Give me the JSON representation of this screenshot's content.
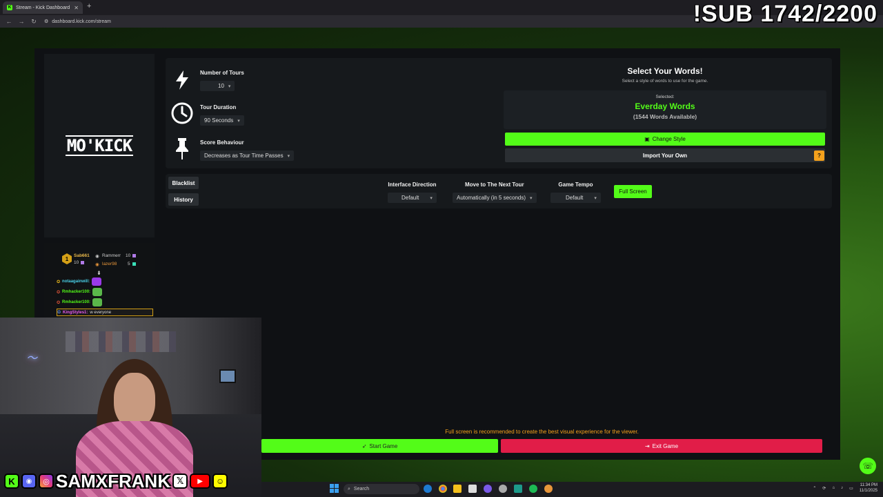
{
  "browser": {
    "tab_title": "Stream - Kick Dashboard",
    "url": "dashboard.kick.com/stream"
  },
  "overlay": {
    "sub_goal": "!SUB 1742/2200"
  },
  "logo": {
    "text": "MO'KICK"
  },
  "settings": {
    "tours_label": "Number of Tours",
    "tours_value": "10",
    "duration_label": "Tour Duration",
    "duration_value": "90 Seconds",
    "score_label": "Score Behaviour",
    "score_value": "Decreases as Tour Time Passes"
  },
  "words": {
    "title": "Select Your Words!",
    "subtitle": "Select a style of words to use for the game.",
    "selected_label": "Selected:",
    "selected_name": "Everday Words",
    "selected_count": "(1544 Words Available)",
    "change_label": "Change Style",
    "import_label": "Import Your Own",
    "help": "?"
  },
  "controls": {
    "blacklist": "Blacklist",
    "history": "History",
    "direction_label": "Interface Direction",
    "direction_value": "Default",
    "next_label": "Move to The Next Tour",
    "next_value": "Automatically (in 5 seconds)",
    "tempo_label": "Game Tempo",
    "tempo_value": "Default",
    "fullscreen": "Full Screen"
  },
  "footer": {
    "hint": "Full screen is recommended to create the best visual experience for the viewer.",
    "start": "Start Game",
    "exit": "Exit Game"
  },
  "leaderboard": {
    "rank": "1",
    "p1_name": "Sab661",
    "p1_score": "10",
    "p2_name": "Rammerr",
    "p2_score": "10",
    "p3_name": "lazer98",
    "p3_score": "5"
  },
  "chat": [
    {
      "user": "notaagainwill:",
      "color": "#4ad0e8"
    },
    {
      "user": "Rmhacker100:",
      "color": "#53fc18"
    },
    {
      "user": "Rmhacker100:",
      "color": "#53fc18"
    },
    {
      "user": "KingStyles1:",
      "color": "#e85af0",
      "message": "w everyone"
    }
  ],
  "social": {
    "handle": "SAMXFRANK"
  },
  "taskbar": {
    "search": "Search",
    "time": "11:34 PM",
    "date": "11/1/2025"
  },
  "colors": {
    "accent": "#53fc18",
    "danger": "#e11d48",
    "warn": "#f4a11c"
  }
}
